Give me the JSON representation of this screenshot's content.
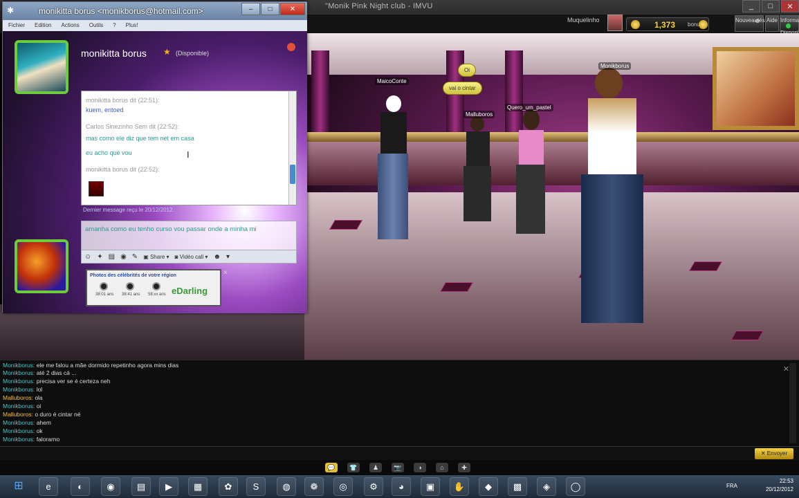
{
  "imvu": {
    "window_title": "\"Monik Pink Night club - IMVU",
    "user": "Muquelinho",
    "credits": "1,373",
    "credits_unit": "bonus",
    "btn_updates": "Nouveautés",
    "btn_help": "Aide",
    "btn_status": "Disponible",
    "btn_status_top": "Informatio"
  },
  "scene": {
    "name_tags": [
      "MaicoConte",
      "Malluboros",
      "Quero_um_pastel",
      "Monikborus"
    ],
    "bubbles": [
      "Oi",
      "vai o cintar"
    ]
  },
  "chat_log": [
    {
      "who": "Monikborus:",
      "msg": "ele me falou a mãe dormido repetinho agora mins dias"
    },
    {
      "who": "Monikborus:",
      "msg": "até 2 dias cá ..."
    },
    {
      "who": "Monikborus:",
      "msg": "precisa ver se é certeza neh"
    },
    {
      "who": "Monikborus:",
      "msg": "lol"
    },
    {
      "who": "Malluboros:",
      "msg": "ola"
    },
    {
      "who": "Monikborus:",
      "msg": "oi"
    },
    {
      "who": "Malluboros:",
      "msg": "o duro é cintar né"
    },
    {
      "who": "Monikborus:",
      "msg": "ahem"
    },
    {
      "who": "Monikborus:",
      "msg": "ok"
    },
    {
      "who": "Monikborus:",
      "msg": "falorarno"
    }
  ],
  "chat_send": "✕ Envoyer",
  "dock": [
    "💬",
    "👕",
    "♟",
    "📷",
    "◑",
    "⌂",
    "✚",
    "🛒",
    "◉",
    "⌨"
  ],
  "msn": {
    "title": "monikitta borus <monikborus@hotmail.com>",
    "menu": [
      "Fichier",
      "Edition",
      "Actions",
      "Outils",
      "?",
      "Plus!"
    ],
    "contact_name": "monikitta borus",
    "status": "(Disponible)",
    "conversation": [
      {
        "text": "monikitta borus dit (22:51):",
        "kind": "hdr"
      },
      {
        "text": "kuem, entoed",
        "kind": "blue"
      },
      {
        "text": "Carlos Sinezinho Sem dit (22:52):",
        "kind": "hdr"
      },
      {
        "text": "mas como ele diz que tem net em casa",
        "kind": "msg"
      },
      {
        "text": "eu acho que vou",
        "kind": "msg"
      },
      {
        "text": "monikitta borus dit (22:52):",
        "kind": "hdr"
      }
    ],
    "last_message": "Dernier message reçu le 20/12/2012.",
    "compose_text": "amanha como eu tenho curso vou passar onde a minha mi",
    "tools": {
      "share": "Share",
      "video": "Vidéo call"
    },
    "ad": {
      "title": "Photos des célébrités de votre région",
      "times": [
        "38:01 ans",
        "38:41 ans",
        "58:xx ans"
      ],
      "logo": "eDarling"
    }
  },
  "taskbar": {
    "lang": "FRA",
    "time": "22:53",
    "date": "20/12/2012",
    "icons": [
      "e",
      "◐",
      "◉",
      "▤",
      "▶",
      "▦",
      "✿",
      "S",
      "◍",
      "❁",
      "◎",
      "⚙",
      "◕",
      "▣",
      "✋",
      "◆",
      "▩",
      "◈",
      "◯"
    ]
  }
}
